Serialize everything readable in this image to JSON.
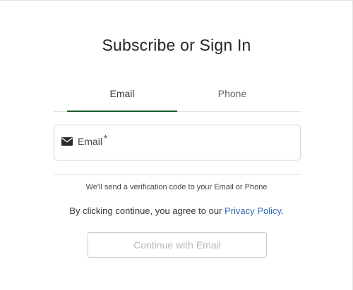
{
  "header": {
    "title": "Subscribe or Sign In"
  },
  "tabs": [
    {
      "label": "Email",
      "selected": true
    },
    {
      "label": "Phone",
      "selected": false
    }
  ],
  "email_field": {
    "icon": "mail-icon",
    "label": "Email",
    "required_mark": "*",
    "value": ""
  },
  "notice": {
    "verify_text": "We'll send a verification code to your Email or Phone",
    "agree_prefix": "By clicking continue, you agree to our ",
    "privacy_link": "Privacy Policy",
    "agree_suffix": "."
  },
  "continue_button": {
    "label": "Continue with Email",
    "disabled": true
  },
  "colors": {
    "accent_underline": "#1d5a2c",
    "link": "#2f6db5",
    "disabled_text": "#b7b7b7"
  }
}
